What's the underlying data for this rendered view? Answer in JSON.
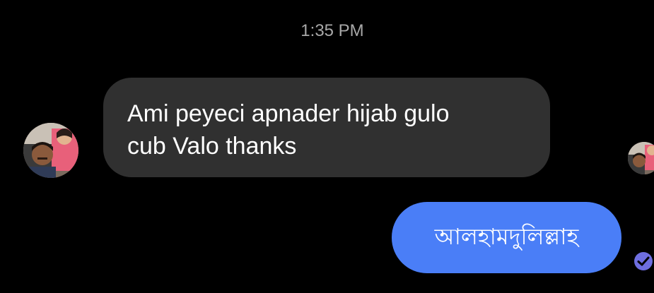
{
  "conversation": {
    "timestamp": "1:35 PM",
    "messages": [
      {
        "direction": "incoming",
        "lines": [
          "Ami peyeci apnader hijab gulo",
          "cub Valo thanks"
        ]
      },
      {
        "direction": "outgoing",
        "text": "আলহামদুলিল্লাহ"
      }
    ]
  },
  "icons": {
    "incoming_avatar": "profile-photo",
    "seen_avatar": "profile-photo-small",
    "delivered_status": "check-circle-icon"
  },
  "colors": {
    "background": "#000000",
    "incoming_bubble": "#303030",
    "outgoing_bubble": "#4a7ef7",
    "timestamp_text": "#a8a8a8",
    "status_icon": "#6e6ee0"
  }
}
